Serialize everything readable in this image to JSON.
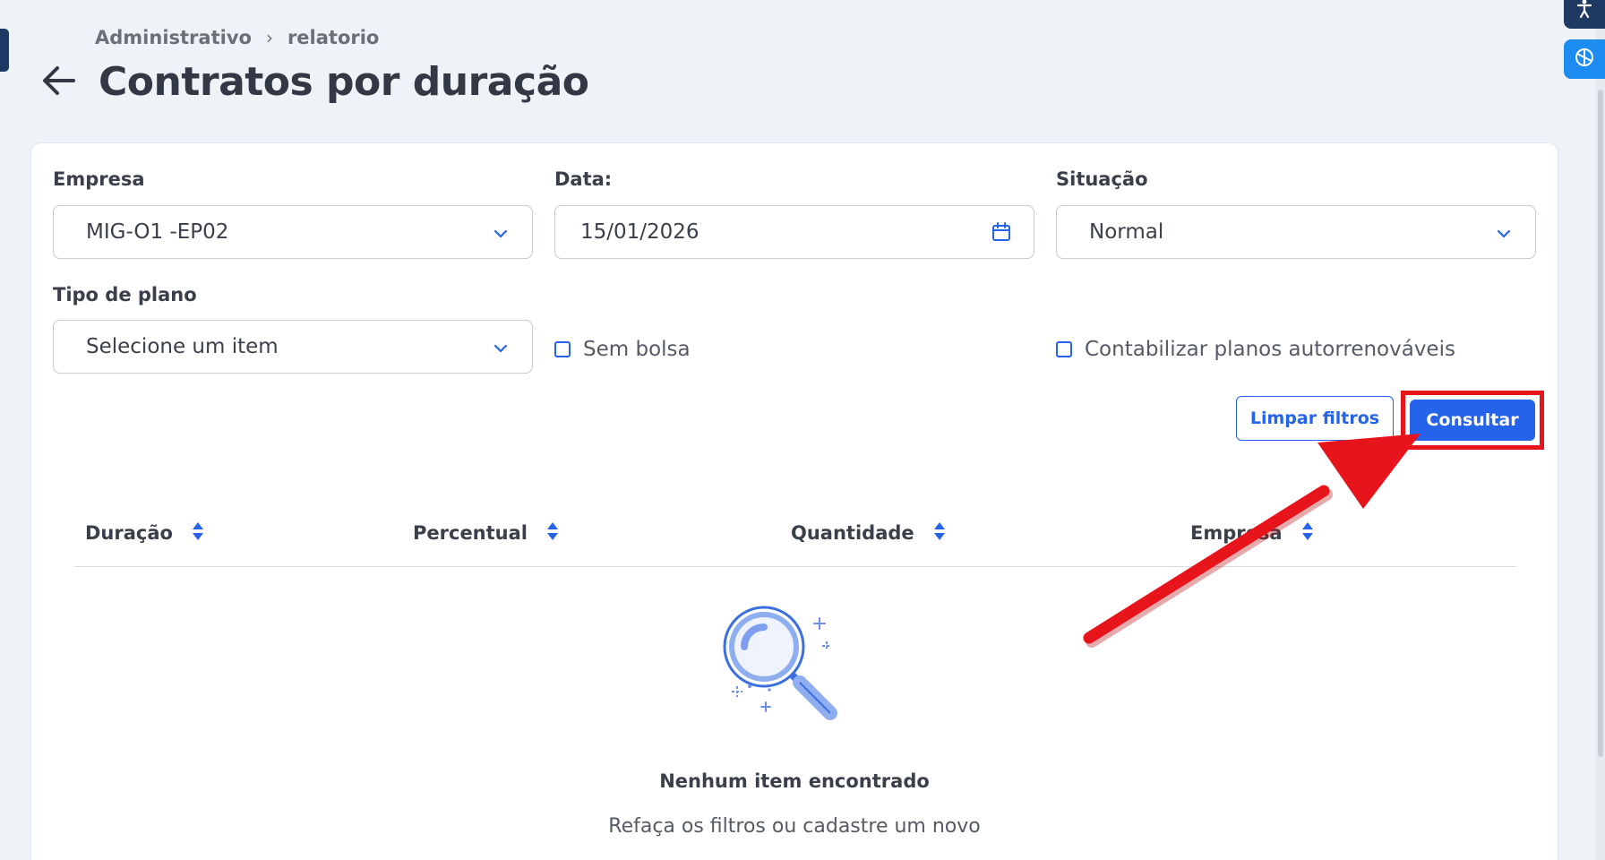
{
  "breadcrumb": {
    "parent": "Administrativo",
    "separator": "›",
    "current": "relatorio"
  },
  "page": {
    "title": "Contratos por duração"
  },
  "filters": {
    "empresa": {
      "label": "Empresa",
      "value": "MIG-O1 -EP02"
    },
    "data": {
      "label": "Data:",
      "value": "15/01/2026"
    },
    "situacao": {
      "label": "Situação",
      "value": "Normal"
    },
    "tipo_plano": {
      "label": "Tipo de plano",
      "value": "Selecione um item"
    },
    "sem_bolsa": {
      "label": "Sem bolsa",
      "checked": false
    },
    "autorrenovaveis": {
      "label": "Contabilizar planos autorrenováveis",
      "checked": false
    }
  },
  "actions": {
    "clear_label": "Limpar filtros",
    "submit_label": "Consultar"
  },
  "table": {
    "columns": [
      "Duração",
      "Percentual",
      "Quantidade",
      "Empresa"
    ]
  },
  "empty_state": {
    "title": "Nenhum item encontrado",
    "subtitle": "Refaça os filtros ou cadastre um novo"
  },
  "colors": {
    "primary": "#2563eb",
    "highlight": "#e8141c",
    "background": "#eff2f7"
  },
  "icons": [
    "back-arrow-icon",
    "chevron-down-icon",
    "calendar-icon",
    "sort-icon",
    "accessibility-icon",
    "chatgpt-icon",
    "magnifier-illustration"
  ]
}
